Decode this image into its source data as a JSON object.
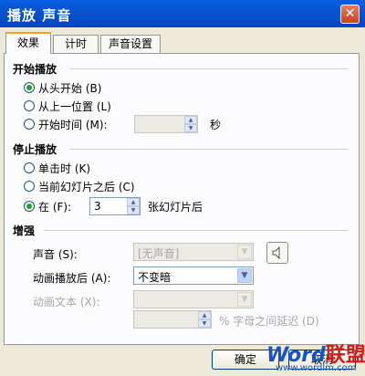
{
  "window": {
    "title": "播放 声音",
    "close_symbol": "✕"
  },
  "tabs": [
    {
      "label": "效果",
      "active": true
    },
    {
      "label": "计时",
      "active": false
    },
    {
      "label": "声音设置",
      "active": false
    }
  ],
  "start_section": {
    "title": "开始播放",
    "options": [
      {
        "label": "从头开始 (B)",
        "checked": true
      },
      {
        "label": "从上一位置 (L)",
        "checked": false
      },
      {
        "label": "开始时间 (M):",
        "checked": false
      }
    ],
    "start_time_value": "",
    "seconds_label": "秒"
  },
  "stop_section": {
    "title": "停止播放",
    "options": [
      {
        "label": "单击时 (K)",
        "checked": false
      },
      {
        "label": "当前幻灯片之后 (C)",
        "checked": false
      },
      {
        "label": "在 (F):",
        "checked": true
      }
    ],
    "after_slides_value": "3",
    "after_slides_label": "张幻灯片后"
  },
  "enhance_section": {
    "title": "增强",
    "sound_label": "声音 (S):",
    "sound_value": "[无声音]",
    "after_animation_label": "动画播放后 (A):",
    "after_animation_value": "不变暗",
    "animate_text_label": "动画文本 (X):",
    "animate_text_value": "",
    "delay_value": "",
    "delay_label": "% 字母之间延迟 (D)"
  },
  "buttons": {
    "ok": "确定",
    "cancel": "取消"
  },
  "watermark": {
    "logo_main": "Word",
    "logo_accent": "联盟",
    "url": "www.wordlm.com"
  },
  "colors": {
    "titlebar": "#0753d2",
    "accent_tab": "#f5a31f",
    "radio_dot": "#21a121"
  }
}
